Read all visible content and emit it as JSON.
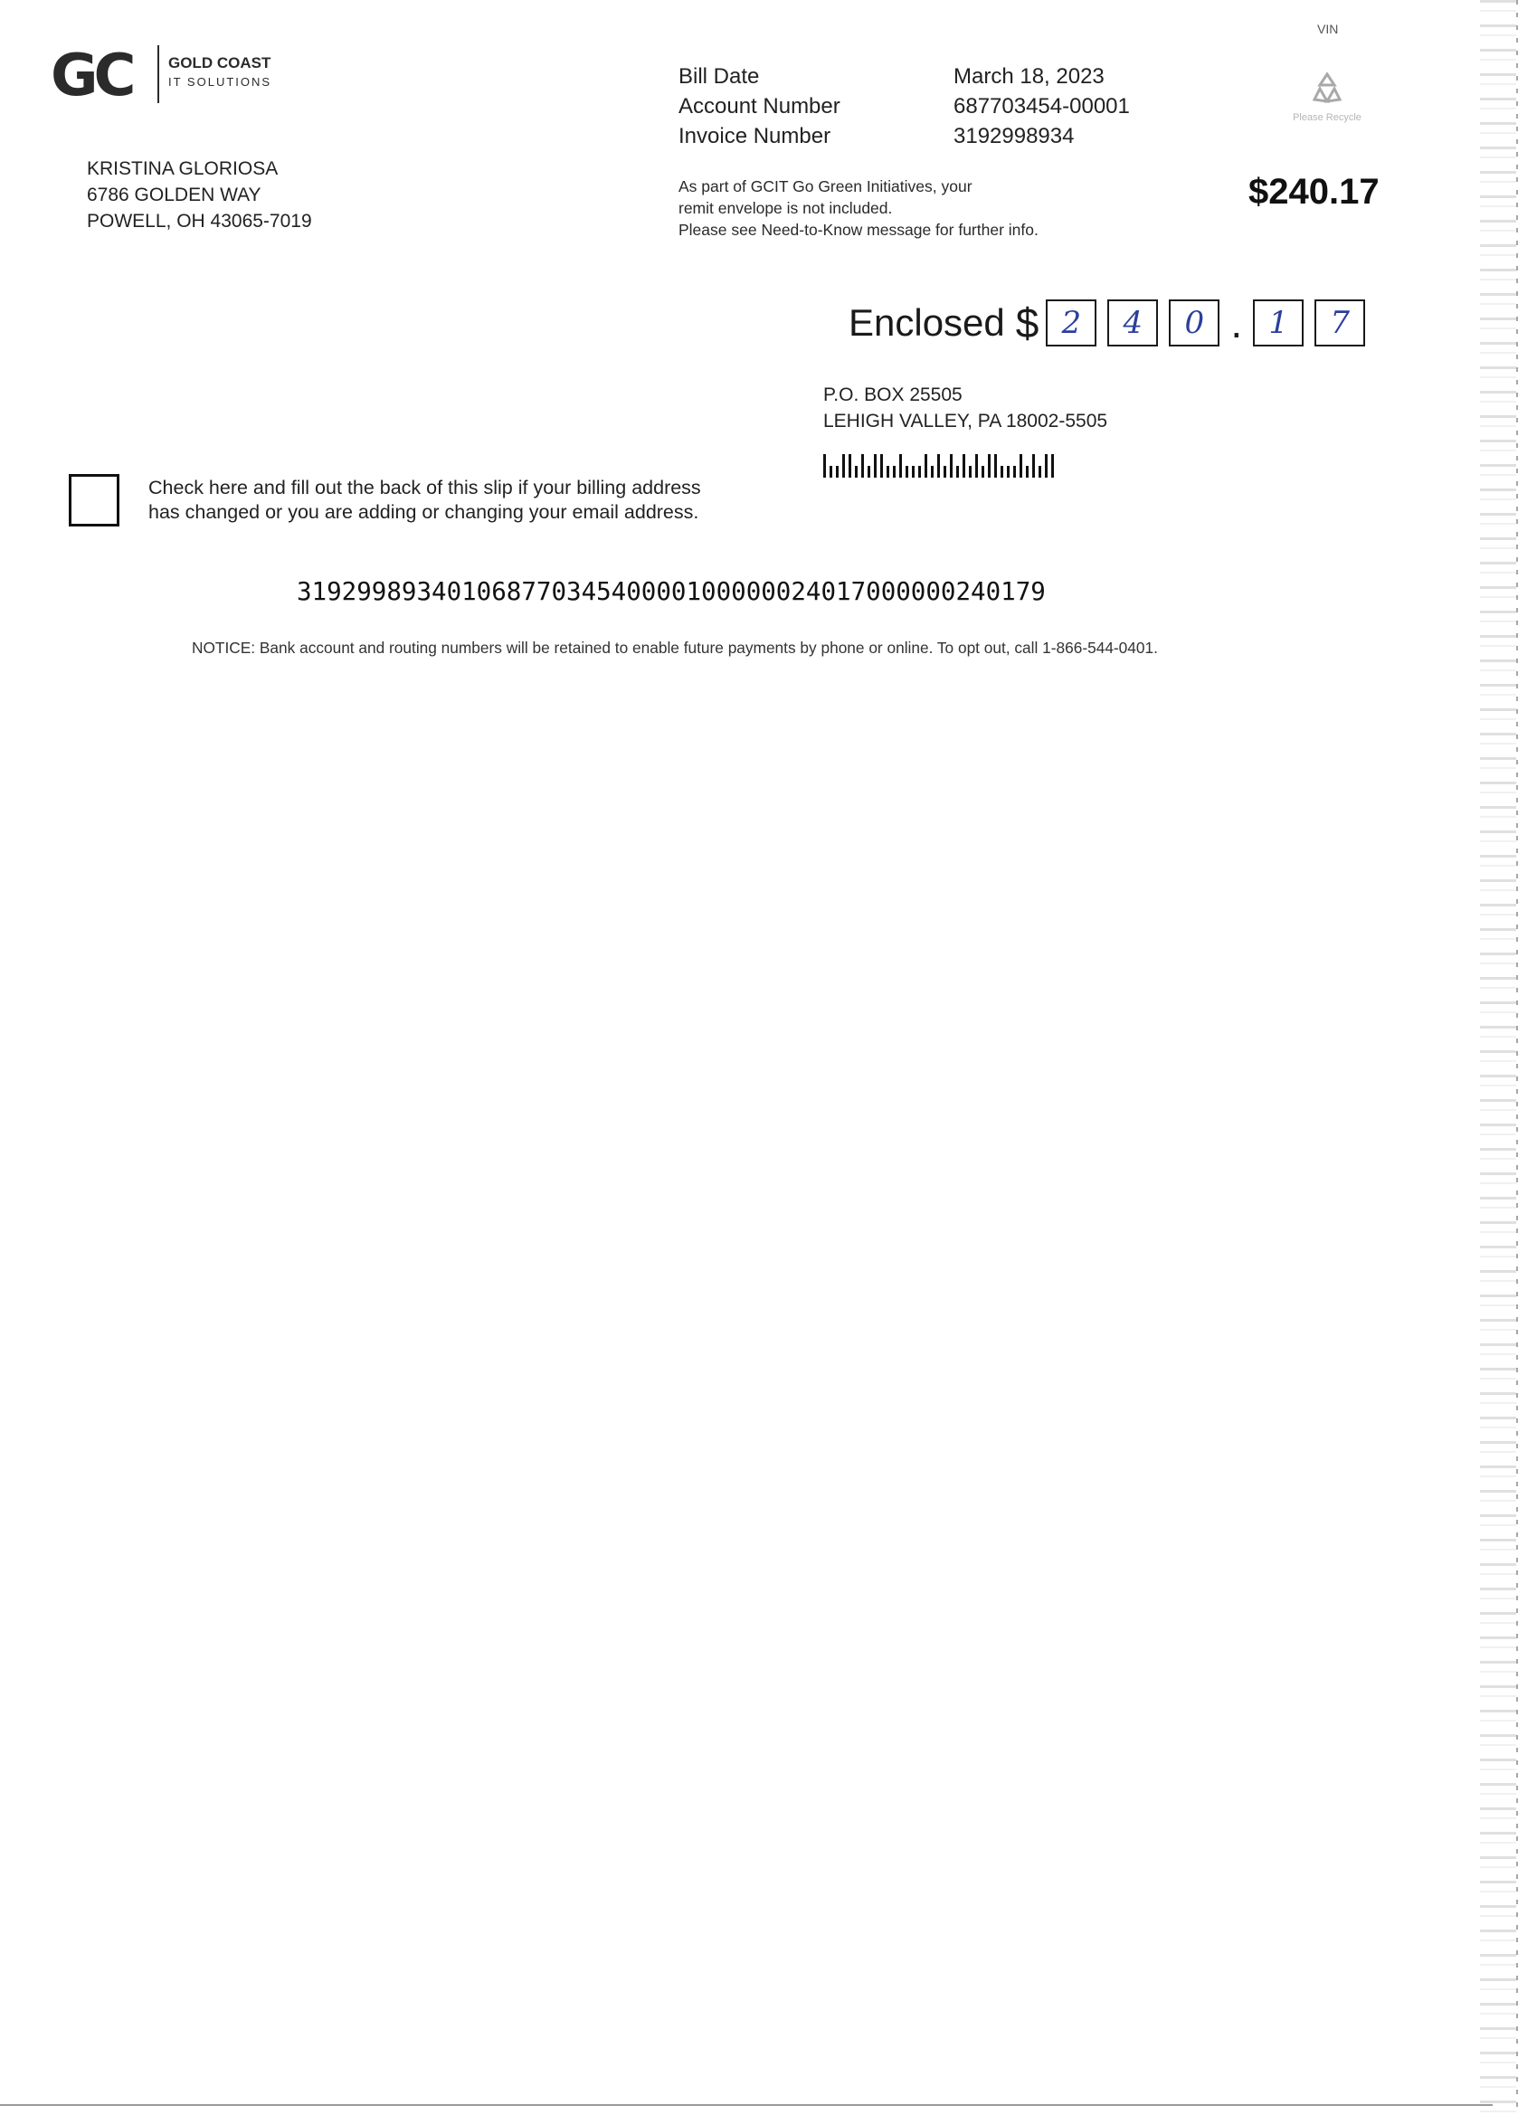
{
  "logo": {
    "mark": "GC",
    "name": "GOLD COAST",
    "tagline": "IT SOLUTIONS"
  },
  "header_marker": "VIN",
  "customer": {
    "name": "KRISTINA GLORIOSA",
    "street": "6786 GOLDEN WAY",
    "city_state_zip": "POWELL, OH  43065-7019"
  },
  "bill_info": [
    {
      "label": "Bill Date",
      "value": "March 18, 2023"
    },
    {
      "label": "Account Number",
      "value": "687703454-00001"
    },
    {
      "label": "Invoice Number",
      "value": "3192998934"
    }
  ],
  "go_green": {
    "line1": "As part of GCIT Go Green Initiatives, your",
    "line2": "remit envelope is not included.",
    "line3": "Please see Need-to-Know message for further info."
  },
  "recycle": {
    "icon": "recycle-icon",
    "label": "Please Recycle"
  },
  "amount_due": "$240.17",
  "enclosed": {
    "label": "Enclosed",
    "currency": "$",
    "digits_before": [
      "2",
      "4",
      "0"
    ],
    "separator": ".",
    "digits_after": [
      "1",
      "7"
    ]
  },
  "remit_address": {
    "line1": "P.O. BOX 25505",
    "line2": "LEHIGH VALLEY,  PA  18002-5505"
  },
  "address_change": {
    "line1": "Check here and fill out the back of this slip if your billing address",
    "line2": "has changed or you are adding or changing your email address."
  },
  "micr_line": "31929989340106877034540000100000024017000000240179",
  "notice": "NOTICE: Bank account and routing numbers will be retained to enable future payments by phone or online. To opt out, call 1-866-544-0401."
}
